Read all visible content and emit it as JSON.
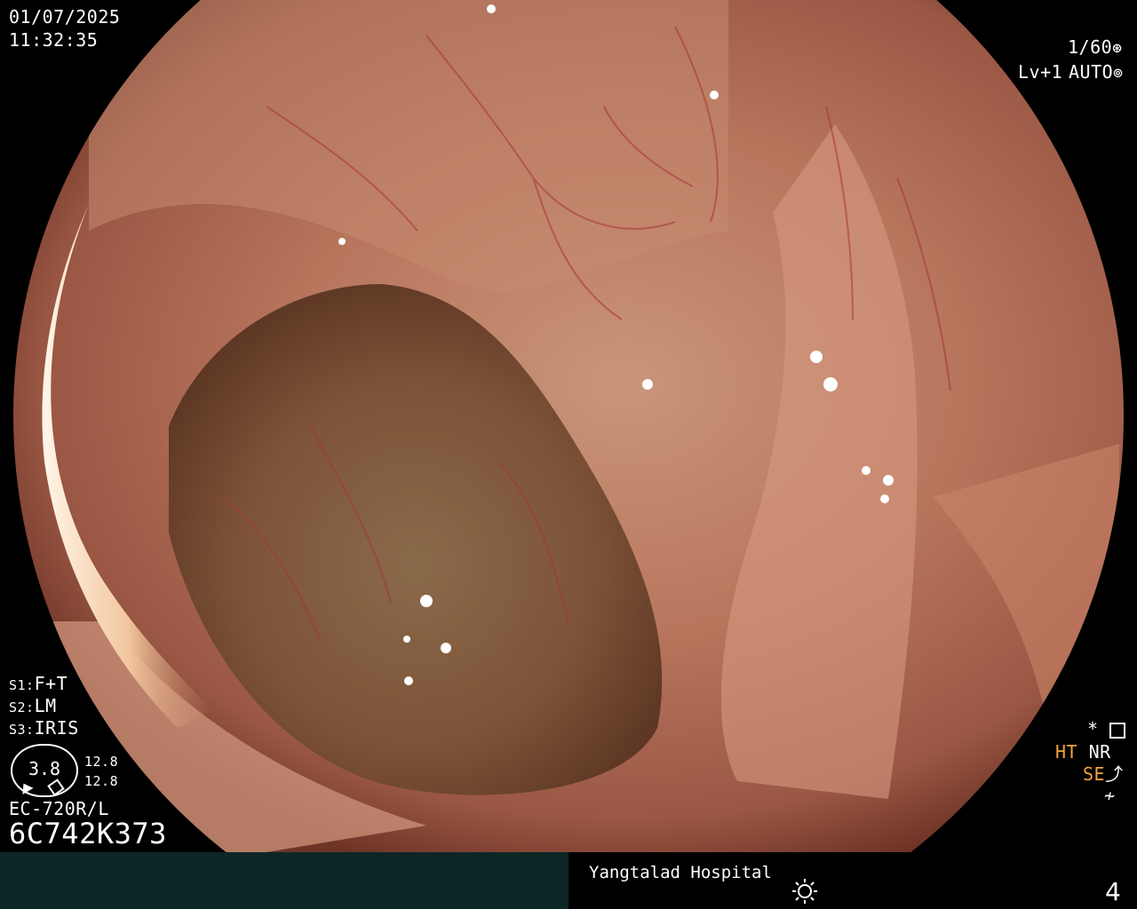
{
  "header": {
    "date": "01/07/2025",
    "time": "11:32:35",
    "shutter": "1/60",
    "level": "Lv+1",
    "mode": "AUTO"
  },
  "settings": {
    "s1_label": "S1:",
    "s1_value": "F+T",
    "s2_label": "S2:",
    "s2_value": "LM",
    "s3_label": "S3:",
    "s3_value": "IRIS"
  },
  "gauge": {
    "value": "3.8",
    "reading_top": "12.8",
    "reading_bottom": "12.8"
  },
  "scope": {
    "model": "EC-720R/L",
    "serial": "6C742K373"
  },
  "status": {
    "star": "*",
    "ht": "HT",
    "nr": "NR",
    "se": "SE"
  },
  "footer": {
    "hospital": "Yangtalad Hospital",
    "number": "4"
  },
  "colors": {
    "accent_orange": "#f2a43a",
    "footer_bar": "#0d2626",
    "tissue": "#b5705a"
  },
  "icons": [
    "aperture-icon",
    "iris-icon",
    "settings-panel-icon",
    "enhancement-icon",
    "flag-icon",
    "brightness-icon"
  ]
}
